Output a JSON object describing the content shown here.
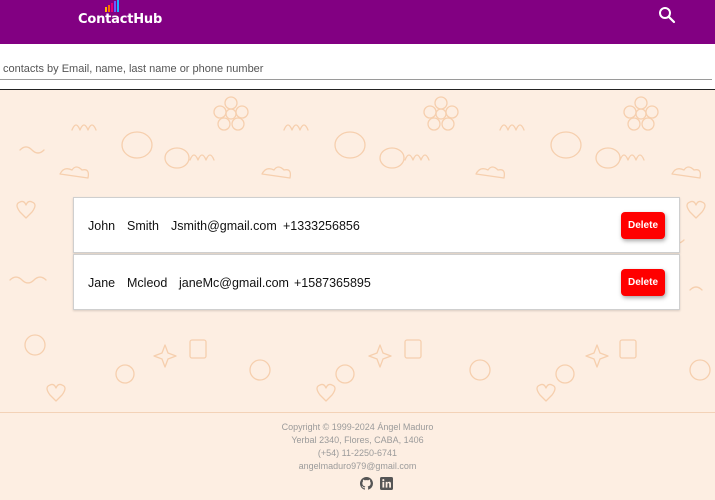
{
  "header": {
    "brand": "ContactHub",
    "background_color": "#820082",
    "search_icon": "search-icon"
  },
  "search": {
    "placeholder": "contacts by Email, name, last name or phone number",
    "value": ""
  },
  "contacts": [
    {
      "first_name": "John",
      "last_name": "Smith",
      "email": "Jsmith@gmail.com",
      "phone": "+1333256856",
      "delete_label": "Delete"
    },
    {
      "first_name": "Jane",
      "last_name": "Mcleod",
      "email": "janeMc@gmail.com",
      "phone": "+1587365895",
      "delete_label": "Delete"
    }
  ],
  "colors": {
    "accent": "#820082",
    "delete": "#ff0000",
    "background": "#fdeee2"
  },
  "footer": {
    "copyright": "Copyright © 1999-2024 Ángel Maduro",
    "address": "Yerbal 2340, Flores, CABA, 1406",
    "phone": "(+54) 11-2250-6741",
    "email": "angelmaduro979@gmail.com",
    "social_icons": [
      "github-icon",
      "linkedin-icon"
    ]
  }
}
